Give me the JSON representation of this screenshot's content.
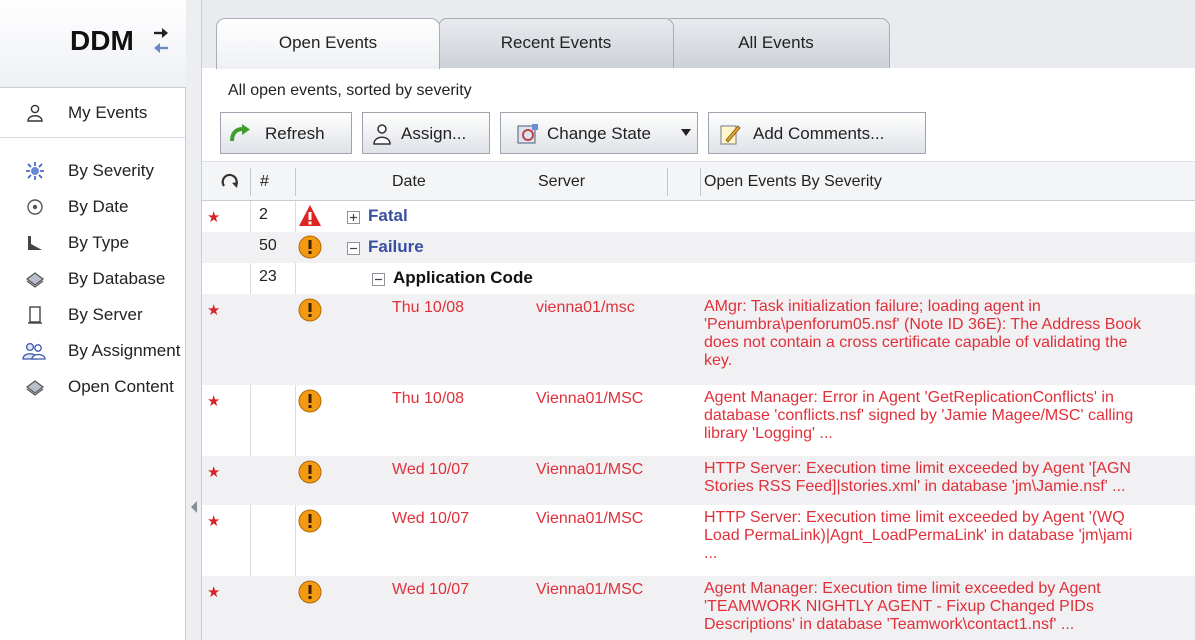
{
  "app": {
    "title": "DDM"
  },
  "sidebar": {
    "my_events": "My Events",
    "items": [
      {
        "label": "By Severity",
        "icon": "severity-icon"
      },
      {
        "label": "By Date",
        "icon": "date-icon"
      },
      {
        "label": "By Type",
        "icon": "type-icon"
      },
      {
        "label": "By Database",
        "icon": "database-icon"
      },
      {
        "label": "By Server",
        "icon": "server-icon"
      },
      {
        "label": "By Assignment",
        "icon": "assignment-icon"
      },
      {
        "label": "Open Content",
        "icon": "content-icon"
      }
    ]
  },
  "tabs": [
    {
      "label": "Open Events",
      "active": true
    },
    {
      "label": "Recent Events",
      "active": false
    },
    {
      "label": "All Events",
      "active": false
    }
  ],
  "view": {
    "subtitle": "All open events, sorted by severity"
  },
  "toolbar": {
    "refresh": "Refresh",
    "assign": "Assign...",
    "change_state": "Change State",
    "add_comments": "Add Comments..."
  },
  "columns": {
    "number": "#",
    "date": "Date",
    "server": "Server",
    "category": "Open Events By Severity"
  },
  "groups": {
    "fatal": {
      "count": "2",
      "label": "Fatal"
    },
    "failure": {
      "count": "50",
      "label": "Failure"
    },
    "app_code": {
      "count": "23",
      "label": "Application Code"
    }
  },
  "events": [
    {
      "date": "Thu 10/08",
      "server": "vienna01/msc",
      "message": "AMgr: Task initialization failure; loading agent in\n'Penumbra\\penforum05.nsf' (Note ID 36E): The Address Book\ndoes not contain a cross certificate capable of validating the\nkey."
    },
    {
      "date": "Thu 10/08",
      "server": "Vienna01/MSC",
      "message": "Agent Manager: Error in Agent 'GetReplicationConflicts' in\ndatabase 'conflicts.nsf' signed by 'Jamie Magee/MSC' calling\nlibrary 'Logging' ..."
    },
    {
      "date": "Wed 10/07",
      "server": "Vienna01/MSC",
      "message": "HTTP Server: Execution time limit exceeded by Agent '[AGN\nStories RSS Feed]|stories.xml' in database 'jm\\Jamie.nsf' ..."
    },
    {
      "date": "Wed 10/07",
      "server": "Vienna01/MSC",
      "message": "HTTP Server: Execution time limit exceeded by Agent '(WQ\nLoad PermaLink)|Agnt_LoadPermaLink' in database 'jm\\jami\n..."
    },
    {
      "date": "Wed 10/07",
      "server": "Vienna01/MSC",
      "message": "Agent Manager: Execution time limit exceeded by Agent\n'TEAMWORK NIGHTLY AGENT - Fixup Changed PIDs\nDescriptions' in database 'Teamwork\\contact1.nsf' ..."
    }
  ],
  "colors": {
    "event_text": "#e0303a",
    "group_blue": "#3a4fa0",
    "star": "#d7252b",
    "warning": "#f39a12"
  }
}
